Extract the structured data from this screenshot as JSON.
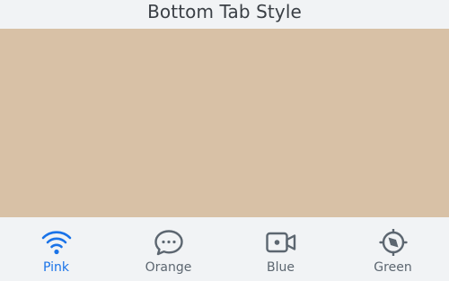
{
  "header": {
    "title": "Bottom Tab Style"
  },
  "content": {
    "background_color": "#d8c1a6"
  },
  "tabs": [
    {
      "label": "Pink",
      "icon": "wifi-icon",
      "active": true
    },
    {
      "label": "Orange",
      "icon": "chat-bubble-icon",
      "active": false
    },
    {
      "label": "Blue",
      "icon": "video-camera-icon",
      "active": false
    },
    {
      "label": "Green",
      "icon": "compass-icon",
      "active": false
    }
  ],
  "colors": {
    "active": "#1a73e8",
    "inactive": "#5c6670",
    "bar_background": "#f1f3f5"
  }
}
